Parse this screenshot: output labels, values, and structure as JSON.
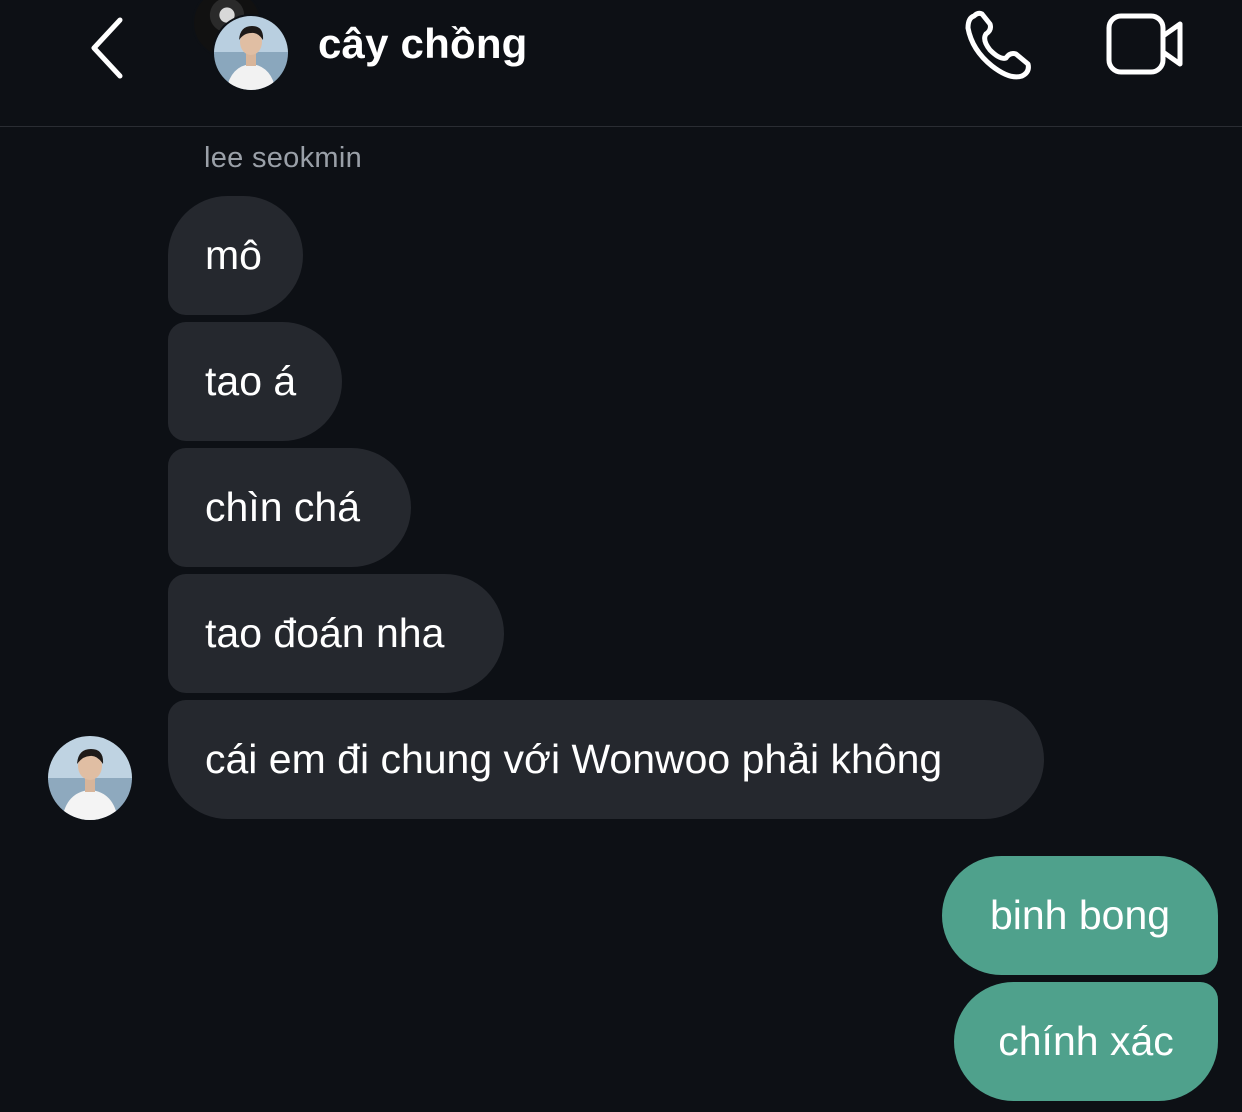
{
  "header": {
    "title": "cây chồng",
    "back_icon": "chevron-left-icon",
    "call_icon": "phone-icon",
    "video_icon": "video-camera-icon"
  },
  "conversation": {
    "sender_name": "lee seokmin",
    "incoming": [
      "mô",
      "tao á",
      "chìn chá",
      "tao đoán nha",
      "cái em đi chung với Wonwoo phải không"
    ],
    "outgoing": [
      "binh bong",
      "chính xác"
    ]
  },
  "colors": {
    "background": "#0d1015",
    "incoming_bubble": "#25282e",
    "outgoing_bubble": "#4fa18c",
    "sender_name": "#9aa0a8"
  }
}
